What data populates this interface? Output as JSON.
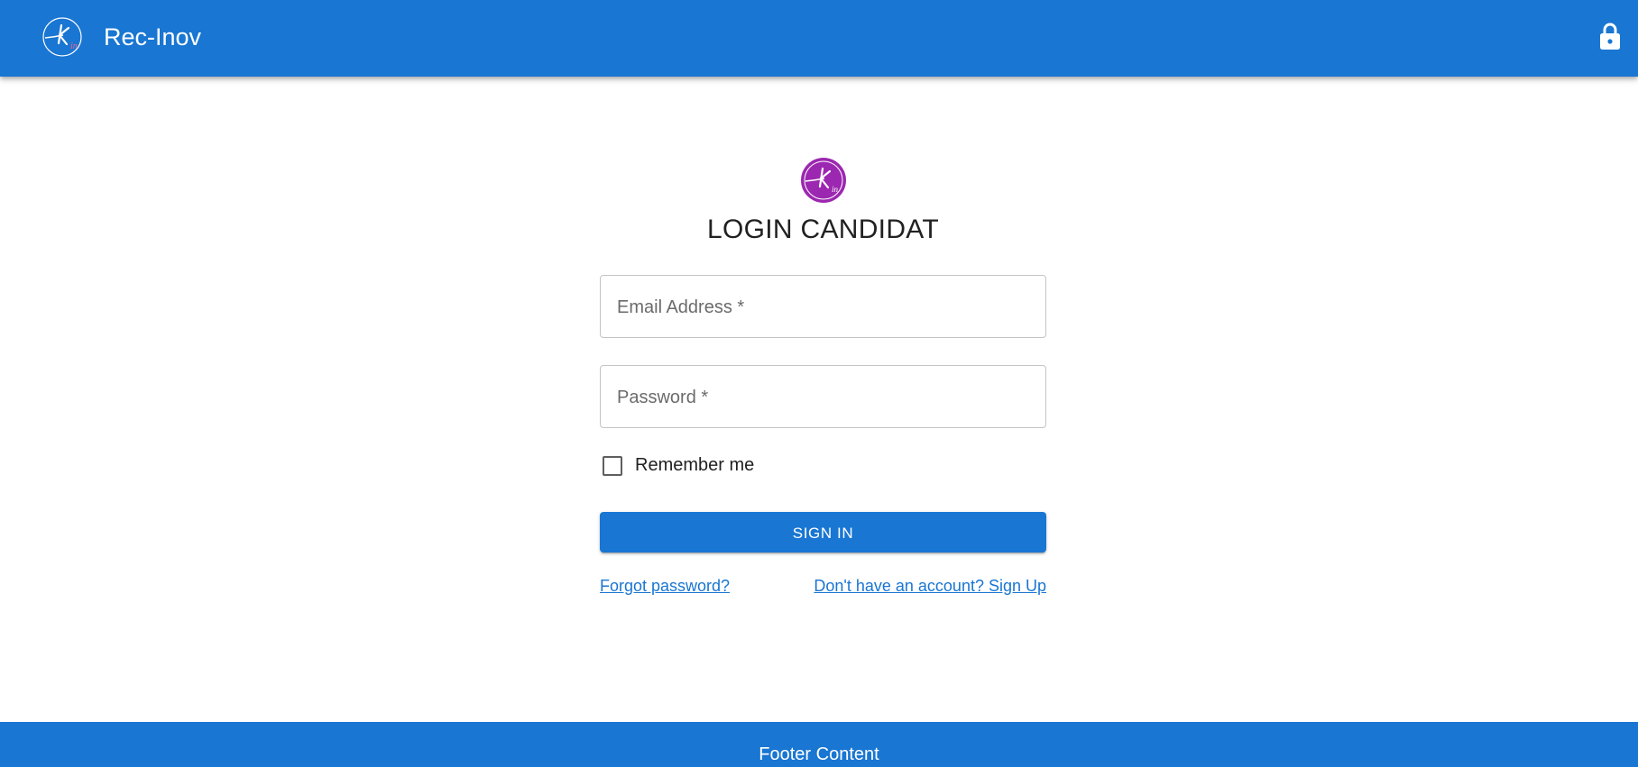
{
  "header": {
    "brand": "Rec-Inov",
    "logo_icon": "rec-inov-logo-icon",
    "lock_icon": "lock-icon"
  },
  "login": {
    "avatar_icon": "rec-inov-logo-icon",
    "title": "LOGIN CANDIDAT",
    "email_placeholder": "Email Address *",
    "email_value": "",
    "password_placeholder": "Password *",
    "password_value": "",
    "remember_label": "Remember me",
    "remember_checked": false,
    "signin_label": "SIGN IN",
    "forgot_link": "Forgot password?",
    "signup_link": "Don't have an account? Sign Up"
  },
  "footer": {
    "text": "Footer Content"
  },
  "colors": {
    "primary": "#1976d2",
    "avatar": "#9c27b0",
    "text": "#212121",
    "border": "#c4c4c4"
  }
}
